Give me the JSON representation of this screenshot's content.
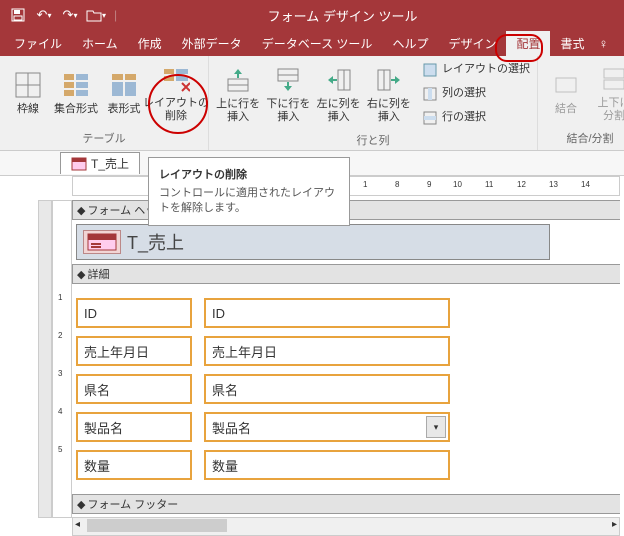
{
  "title_bar": {
    "context_title": "フォーム デザイン ツール"
  },
  "menu": {
    "items": [
      "ファイル",
      "ホーム",
      "作成",
      "外部データ",
      "データベース ツール",
      "ヘルプ",
      "デザイン",
      "配置",
      "書式"
    ],
    "active": "配置"
  },
  "ribbon": {
    "group_table": {
      "label": "テーブル",
      "gridlines": "枠線",
      "stacked": "集合形式",
      "tabular": "表形式",
      "remove_layout": "レイアウトの\n削除"
    },
    "group_rowscols": {
      "label": "行と列",
      "insert_above": "上に行を\n挿入",
      "insert_below": "下に行を\n挿入",
      "insert_left": "左に列を\n挿入",
      "insert_right": "右に列を\n挿入",
      "select_layout": "レイアウトの選択",
      "select_col": "列の選択",
      "select_row": "行の選択"
    },
    "group_merge": {
      "label": "結合/分割",
      "merge": "結合",
      "split_v": "上下に\n分割"
    }
  },
  "tooltip": {
    "title": "レイアウトの削除",
    "body": "コントロールに適用されたレイアウトを解除します。"
  },
  "doc_tab": {
    "name": "T_売上"
  },
  "form": {
    "header_section": "フォーム ヘッダー",
    "detail_section": "詳細",
    "footer_section": "フォーム フッター",
    "title_label": "T_売上",
    "fields": [
      {
        "label": "ID",
        "control": "ID",
        "combo": false
      },
      {
        "label": "売上年月日",
        "control": "売上年月日",
        "combo": false
      },
      {
        "label": "県名",
        "control": "県名",
        "combo": false
      },
      {
        "label": "製品名",
        "control": "製品名",
        "combo": true
      },
      {
        "label": "数量",
        "control": "数量",
        "combo": false
      }
    ]
  }
}
